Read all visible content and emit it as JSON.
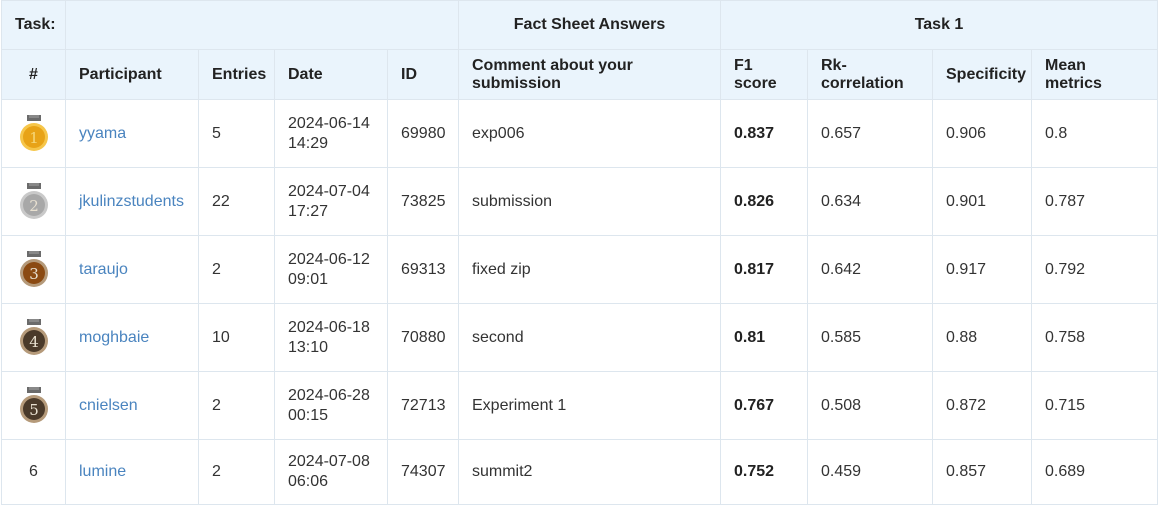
{
  "header": {
    "task_label": "Task:",
    "group_fact_sheet": "Fact Sheet Answers",
    "group_task1": "Task 1",
    "columns": {
      "rank": "#",
      "participant": "Participant",
      "entries": "Entries",
      "date": "Date",
      "id": "ID",
      "comment": "Comment about your submission",
      "f1": "F1 score",
      "rk": "Rk-correlation",
      "specificity": "Specificity",
      "mean": "Mean metrics"
    }
  },
  "medals": {
    "gold": "#e8a317",
    "silver": "#a8a8a8",
    "bronze": "#8b4a12",
    "dark": "#4a3a2a",
    "ribbon": "#6b6b6b"
  },
  "rows": [
    {
      "rank": "1",
      "participant": "yyama",
      "entries": "5",
      "date_line1": "2024-06-14",
      "date_line2": "14:29",
      "id": "69980",
      "comment": "exp006",
      "f1": "0.837",
      "rk": "0.657",
      "specificity": "0.906",
      "mean": "0.8"
    },
    {
      "rank": "2",
      "participant": "jkulinzstudents",
      "entries": "22",
      "date_line1": "2024-07-04",
      "date_line2": "17:27",
      "id": "73825",
      "comment": "submission",
      "f1": "0.826",
      "rk": "0.634",
      "specificity": "0.901",
      "mean": "0.787"
    },
    {
      "rank": "3",
      "participant": "taraujo",
      "entries": "2",
      "date_line1": "2024-06-12",
      "date_line2": "09:01",
      "id": "69313",
      "comment": "fixed zip",
      "f1": "0.817",
      "rk": "0.642",
      "specificity": "0.917",
      "mean": "0.792"
    },
    {
      "rank": "4",
      "participant": "moghbaie",
      "entries": "10",
      "date_line1": "2024-06-18",
      "date_line2": "13:10",
      "id": "70880",
      "comment": "second",
      "f1": "0.81",
      "rk": "0.585",
      "specificity": "0.88",
      "mean": "0.758"
    },
    {
      "rank": "5",
      "participant": "cnielsen",
      "entries": "2",
      "date_line1": "2024-06-28",
      "date_line2": "00:15",
      "id": "72713",
      "comment": "Experiment 1",
      "f1": "0.767",
      "rk": "0.508",
      "specificity": "0.872",
      "mean": "0.715"
    },
    {
      "rank": "6",
      "participant": "lumine",
      "entries": "2",
      "date_line1": "2024-07-08",
      "date_line2": "06:06",
      "id": "74307",
      "comment": "summit2",
      "f1": "0.752",
      "rk": "0.459",
      "specificity": "0.857",
      "mean": "0.689"
    }
  ]
}
